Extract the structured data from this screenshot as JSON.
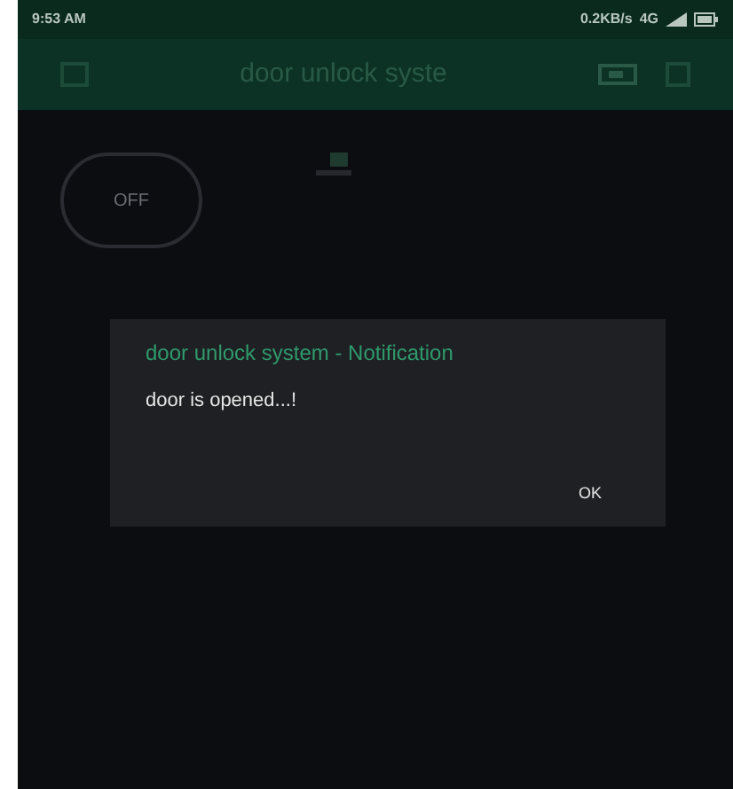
{
  "status_bar": {
    "time": "9:53 AM",
    "speed": "0.2KB/s",
    "network": "4G"
  },
  "header": {
    "title": "door unlock syste"
  },
  "widget": {
    "label": "OFF",
    "on": false
  },
  "dialog": {
    "title": "door unlock system - Notification",
    "message": "door is opened...!",
    "button": "OK"
  }
}
